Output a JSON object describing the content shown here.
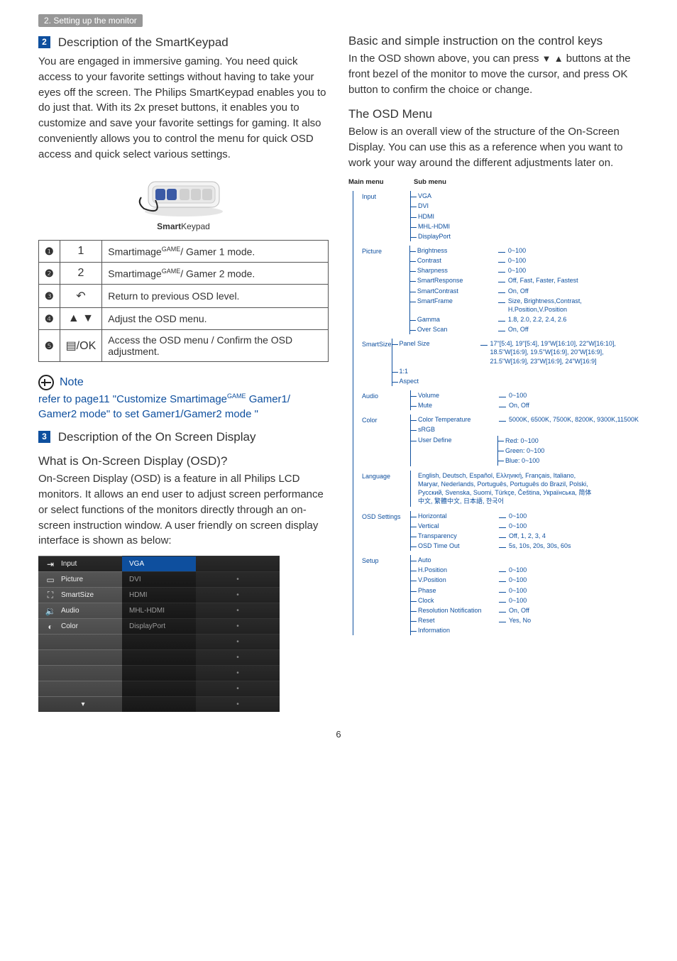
{
  "breadcrumb": "2. Setting up the monitor",
  "section2": {
    "title": "Description of the SmartKeypad",
    "body": "You are engaged in immersive gaming. You need quick access to your favorite settings without having to take your eyes off the screen. The Philips SmartKeypad enables you to do just that. With its 2x preset buttons, it enables you to customize and save your favorite settings for gaming. It also conveniently allows you to control the menu for quick OSD access and quick select various settings.",
    "caption_bold": "Smart",
    "caption_rest": "Keypad"
  },
  "iconmap": [
    {
      "num": "❶",
      "icon": "1",
      "label_pre": "Smartimage",
      "label_sup": "GAME",
      "label_post": "/ Gamer 1 mode."
    },
    {
      "num": "❷",
      "icon": "2",
      "label_pre": "Smartimage",
      "label_sup": "GAME",
      "label_post": "/ Gamer 2 mode."
    },
    {
      "num": "❸",
      "icon": "↶",
      "label_pre": "Return to previous OSD level.",
      "label_sup": "",
      "label_post": ""
    },
    {
      "num": "❹",
      "icon": "▲ ▼",
      "label_pre": "Adjust the OSD menu.",
      "label_sup": "",
      "label_post": ""
    },
    {
      "num": "❺",
      "icon": "▤/OK",
      "label_pre": "Access the OSD menu / Confirm the OSD adjustment.",
      "label_sup": "",
      "label_post": ""
    }
  ],
  "note": {
    "title": "Note",
    "body_pre": "refer to page11 \"Customize Smartimage",
    "body_sup": "GAME",
    "body_post": " Gamer1/ Gamer2 mode\" to set Gamer1/Gamer2 mode \""
  },
  "section3": {
    "title": "Description of the On Screen Display",
    "q": "What is On-Screen Display (OSD)?",
    "body": "On-Screen Display (OSD) is a feature in all Philips LCD monitors. It allows an end user to adjust screen performance or select functions of the monitors directly through an on-screen instruction window. A user friendly on screen display interface is shown as below:"
  },
  "osd_mock": {
    "left": [
      "Input",
      "Picture",
      "SmartSize",
      "Audio",
      "Color"
    ],
    "mid": [
      "VGA",
      "DVI",
      "HDMI",
      "MHL-HDMI",
      "DisplayPort",
      "",
      "",
      "",
      "",
      ""
    ],
    "dot": "•",
    "arrow_down": "▾"
  },
  "right": {
    "h1": "Basic and simple instruction on the control keys",
    "p1_pre": "In the OSD shown above, you can press ",
    "p1_mid": " buttons at the front bezel of the monitor to move the cursor, and press ",
    "ok": "OK",
    "p1_post": " button to confirm the choice or change.",
    "h2": "The OSD Menu",
    "p2": "Below is an overall view of the structure of the On-Screen Display. You can use this as a reference when you want to work your way around the different adjustments later on.",
    "tree_heads": {
      "main": "Main menu",
      "sub": "Sub menu"
    }
  },
  "tree": [
    {
      "main": "Input",
      "subs": [
        {
          "s": "VGA"
        },
        {
          "s": "DVI"
        },
        {
          "s": "HDMI"
        },
        {
          "s": "MHL-HDMI"
        },
        {
          "s": "DisplayPort"
        }
      ]
    },
    {
      "main": "Picture",
      "subs": [
        {
          "s": "Brightness",
          "v": "0~100"
        },
        {
          "s": "Contrast",
          "v": "0~100"
        },
        {
          "s": "Sharpness",
          "v": "0~100"
        },
        {
          "s": "SmartResponse",
          "v": "Off, Fast, Faster, Fastest"
        },
        {
          "s": "SmartContrast",
          "v": "On, Off"
        },
        {
          "s": "SmartFrame",
          "v": "Size, Brightness,Contrast, H.Position,V.Position"
        },
        {
          "s": "Gamma",
          "v": "1.8, 2.0, 2.2, 2.4, 2.6"
        },
        {
          "s": "Over Scan",
          "v": "On, Off"
        }
      ]
    },
    {
      "main": "SmartSize",
      "subs": [
        {
          "s": "Panel Size",
          "v": "17\"[5:4], 19\"[5:4], 19\"W[16:10], 22\"W[16:10], 18.5\"W[16:9], 19.5\"W[16:9], 20\"W[16:9], 21.5\"W[16:9], 23\"W[16:9], 24\"W[16:9]"
        },
        {
          "s": "1:1"
        },
        {
          "s": "Aspect"
        }
      ]
    },
    {
      "main": "Audio",
      "subs": [
        {
          "s": "Volume",
          "v": "0~100"
        },
        {
          "s": "Mute",
          "v": "On, Off"
        }
      ]
    },
    {
      "main": "Color",
      "subs": [
        {
          "s": "Color Temperature",
          "v": "5000K, 6500K, 7500K, 8200K, 9300K,11500K"
        },
        {
          "s": "sRGB"
        },
        {
          "s": "User Define",
          "vgroup": [
            "Red: 0~100",
            "Green: 0~100",
            "Blue: 0~100"
          ]
        }
      ]
    },
    {
      "main": "Language",
      "lang": "English, Deutsch, Español, Ελληνική, Français, Italiano, Maryar, Nederlands, Português, Português do Brazil, Polski, Русский, Svenska, Suomi, Türkçe, Čeština, Українська, 简体中文, 繁體中文, 日本語, 한국어"
    },
    {
      "main": "OSD Settings",
      "subs": [
        {
          "s": "Horizontal",
          "v": "0~100"
        },
        {
          "s": "Vertical",
          "v": "0~100"
        },
        {
          "s": "Transparency",
          "v": "Off, 1, 2, 3, 4"
        },
        {
          "s": "OSD Time Out",
          "v": "5s, 10s, 20s, 30s, 60s"
        }
      ]
    },
    {
      "main": "Setup",
      "subs": [
        {
          "s": "Auto"
        },
        {
          "s": "H.Position",
          "v": "0~100"
        },
        {
          "s": "V.Position",
          "v": "0~100"
        },
        {
          "s": "Phase",
          "v": "0~100"
        },
        {
          "s": "Clock",
          "v": "0~100"
        },
        {
          "s": "Resolution Notification",
          "v": "On, Off"
        },
        {
          "s": "Reset",
          "v": "Yes, No"
        },
        {
          "s": "Information"
        }
      ]
    }
  ],
  "pagenum": "6"
}
